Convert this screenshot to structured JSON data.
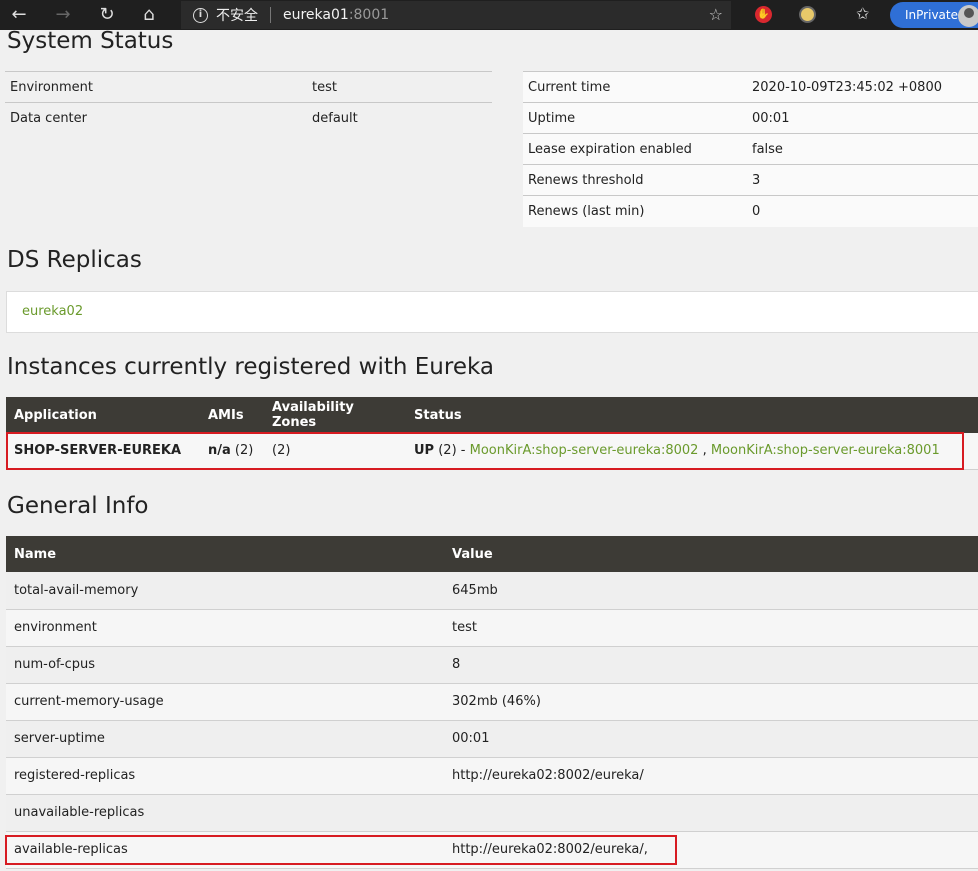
{
  "browser": {
    "insecure_label": "不安全",
    "url_host": "eureka01",
    "url_port": ":8001",
    "inprivate_label": "InPrivate"
  },
  "system_status": {
    "title": "System Status",
    "left": [
      {
        "key": "Environment",
        "value": "test"
      },
      {
        "key": "Data center",
        "value": "default"
      }
    ],
    "right": [
      {
        "key": "Current time",
        "value": "2020-10-09T23:45:02 +0800"
      },
      {
        "key": "Uptime",
        "value": "00:01"
      },
      {
        "key": "Lease expiration enabled",
        "value": "false"
      },
      {
        "key": "Renews threshold",
        "value": "3"
      },
      {
        "key": "Renews (last min)",
        "value": "0"
      }
    ]
  },
  "ds_replicas": {
    "title": "DS Replicas",
    "items": [
      "eureka02"
    ]
  },
  "instances": {
    "title": "Instances currently registered with Eureka",
    "headers": [
      "Application",
      "AMIs",
      "Availability Zones",
      "Status"
    ],
    "rows": [
      {
        "application": "SHOP-SERVER-EUREKA",
        "amis_value": "n/a",
        "amis_count": "(2)",
        "zones": "(2)",
        "status_state": "UP",
        "status_count": "(2) -",
        "instance1": "MoonKirA:shop-server-eureka:8002",
        "separator": ",",
        "instance2": "MoonKirA:shop-server-eureka:8001"
      }
    ]
  },
  "general_info": {
    "title": "General Info",
    "headers": [
      "Name",
      "Value"
    ],
    "rows": [
      {
        "name": "total-avail-memory",
        "value": "645mb"
      },
      {
        "name": "environment",
        "value": "test"
      },
      {
        "name": "num-of-cpus",
        "value": "8"
      },
      {
        "name": "current-memory-usage",
        "value": "302mb (46%)"
      },
      {
        "name": "server-uptime",
        "value": "00:01"
      },
      {
        "name": "registered-replicas",
        "value": "http://eureka02:8002/eureka/"
      },
      {
        "name": "unavailable-replicas",
        "value": ""
      },
      {
        "name": "available-replicas",
        "value": "http://eureka02:8002/eureka/,"
      }
    ]
  },
  "colors": {
    "link": "#6a9a2c",
    "table_header_bg": "#3d3b36",
    "highlight_box": "#d71b22",
    "inprivate_bg": "#2f6fd6"
  }
}
